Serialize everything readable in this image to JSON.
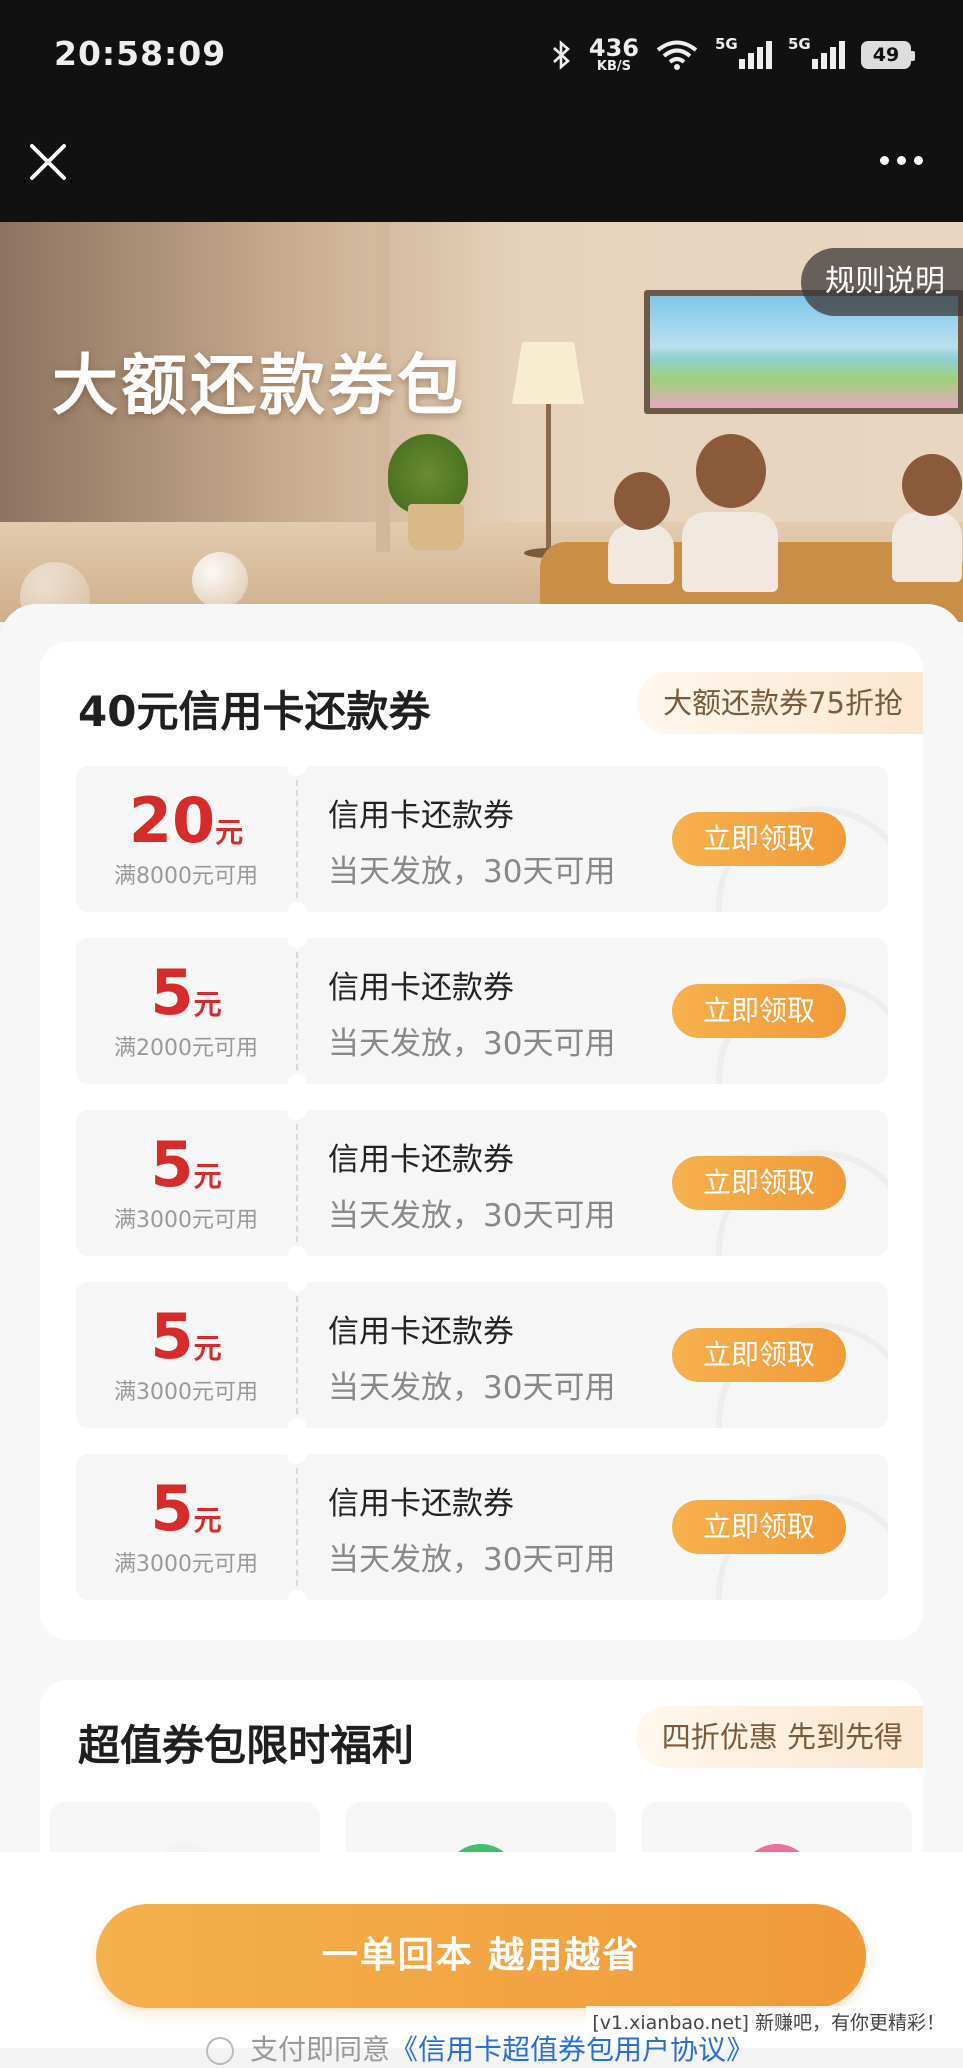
{
  "status_bar": {
    "time": "20:58:09",
    "net_speed": "436",
    "net_unit": "KB/S",
    "sim1": "5G",
    "sim2": "5G",
    "battery": "49"
  },
  "hero": {
    "title": "大额还款券包",
    "rules_label": "规则说明"
  },
  "section1": {
    "title": "40元信用卡还款券",
    "badge": "大额还款券75折抢",
    "coupons": [
      {
        "amount": "20",
        "unit": "元",
        "condition": "满8000元可用",
        "name": "信用卡还款券",
        "desc": "当天发放，30天可用",
        "button": "立即领取"
      },
      {
        "amount": "5",
        "unit": "元",
        "condition": "满2000元可用",
        "name": "信用卡还款券",
        "desc": "当天发放，30天可用",
        "button": "立即领取"
      },
      {
        "amount": "5",
        "unit": "元",
        "condition": "满3000元可用",
        "name": "信用卡还款券",
        "desc": "当天发放，30天可用",
        "button": "立即领取"
      },
      {
        "amount": "5",
        "unit": "元",
        "condition": "满3000元可用",
        "name": "信用卡还款券",
        "desc": "当天发放，30天可用",
        "button": "立即领取"
      },
      {
        "amount": "5",
        "unit": "元",
        "condition": "满3000元可用",
        "name": "信用卡还款券",
        "desc": "当天发放，30天可用",
        "button": "立即领取"
      }
    ]
  },
  "section2": {
    "title": "超值券包限时福利",
    "badge": "四折优惠 先到先得"
  },
  "bottom": {
    "cta": "一单回本 越用越省",
    "agreement_prefix": "支付即同意",
    "agreement_link": "《信用卡超值券包用户协议》"
  },
  "watermark": "[v1.xianbao.net] 新赚吧，有你更精彩！",
  "colors": {
    "accent_orange": "#f4a845",
    "price_red": "#d62b2b",
    "link_blue": "#2a6fd6"
  }
}
